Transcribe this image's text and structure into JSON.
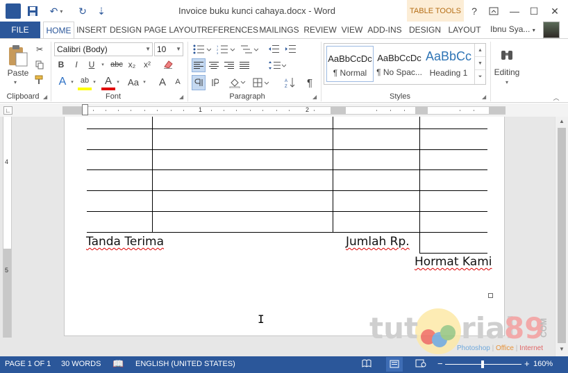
{
  "window": {
    "title": "Invoice buku kunci cahaya.docx - Word",
    "contextual_tab": "TABLE TOOLS",
    "help": "?",
    "minimize": "—",
    "maximize": "☐",
    "close": "✕"
  },
  "quick_access": {
    "word_logo": "W",
    "save": "💾",
    "undo": "↶",
    "undo_arrow": "▾",
    "redo": "↻",
    "customize": "⇣"
  },
  "tabs": {
    "file": "FILE",
    "home": "HOME",
    "insert": "INSERT",
    "design": "DESIGN",
    "page_layout": "PAGE LAYOUT",
    "references": "REFERENCES",
    "mailings": "MAILINGS",
    "review": "REVIEW",
    "view": "VIEW",
    "add_ins": "ADD-INS",
    "table_design": "DESIGN",
    "table_layout": "LAYOUT"
  },
  "user": {
    "name": "Ibnu Sya...",
    "arrow": "▾"
  },
  "ribbon": {
    "clipboard": {
      "label": "Clipboard",
      "paste": "Paste",
      "paste_arrow": "▾"
    },
    "font": {
      "label": "Font",
      "font_name": "Calibri (Body)",
      "font_size": "10",
      "bold": "B",
      "italic": "I",
      "underline": "U",
      "strikethrough": "abc",
      "subscript": "x₂",
      "superscript": "x²",
      "text_effects": "A",
      "highlight": "ab",
      "font_color": "A",
      "change_case": "Aa",
      "grow": "A",
      "shrink": "A"
    },
    "paragraph": {
      "label": "Paragraph",
      "show_marks": "¶"
    },
    "styles": {
      "label": "Styles",
      "items": [
        {
          "preview": "AaBbCcDc",
          "name": "¶ Normal"
        },
        {
          "preview": "AaBbCcDc",
          "name": "¶ No Spac..."
        },
        {
          "preview": "AaBbCc",
          "name": "Heading 1"
        }
      ]
    },
    "editing": {
      "label": "Editing",
      "arrow": "▾"
    }
  },
  "ruler": {
    "tab_selector": "∟",
    "marks": [
      "1",
      "2"
    ]
  },
  "vertical_ruler": {
    "marks": [
      "4",
      "5"
    ]
  },
  "document": {
    "tanda_terima": "Tanda Terima",
    "jumlah": "Jumlah Rp.",
    "hormat_kami": "Hormat Kami"
  },
  "watermark": {
    "text_left": "tut",
    "text_right": "rial",
    "number": "89",
    "domain": "COM",
    "sub_photoshop": "Photoshop",
    "sub_office": "Office",
    "sub_internet": "Internet"
  },
  "status": {
    "page": "PAGE 1 OF 1",
    "words": "30 WORDS",
    "language": "ENGLISH (UNITED STATES)",
    "zoom": "160%",
    "zoom_out": "−",
    "zoom_in": "+"
  },
  "colors": {
    "accent": "#2b579a",
    "table_tools": "#fcedd6",
    "spell_error": "#dd0000"
  }
}
